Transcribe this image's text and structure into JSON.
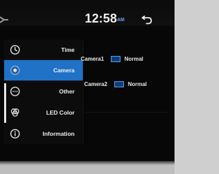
{
  "status_bar": {
    "time": "12:58",
    "ampm": "AM",
    "back_icon": "back-arrow-icon"
  },
  "sidebar": {
    "items": [
      {
        "label": "Time",
        "icon": "clock-icon"
      },
      {
        "label": "Camera",
        "icon": "camera-icon",
        "active": true
      },
      {
        "label": "Other",
        "icon": "more-dots-icon"
      },
      {
        "label": "LED Color",
        "icon": "color-circles-icon"
      },
      {
        "label": "Information",
        "icon": "info-icon"
      }
    ]
  },
  "cameras": [
    {
      "name": "Camera1",
      "mode": "Normal"
    },
    {
      "name": "Camera2",
      "mode": "Normal"
    }
  ],
  "colors": {
    "active_item": "#1f72c6",
    "accent": "#5aa3ff"
  }
}
